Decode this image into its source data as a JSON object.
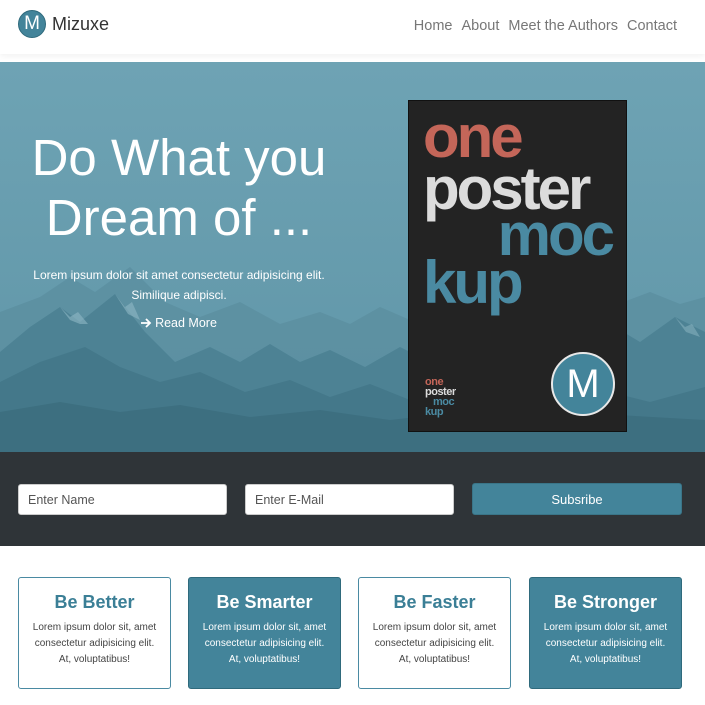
{
  "header": {
    "logo_letter": "M",
    "brand": "Mizuxe",
    "nav": [
      "Home",
      "About",
      "Meet the Authors",
      "Contact"
    ]
  },
  "hero": {
    "title_line1": "Do What you",
    "title_line2": "Dream of ...",
    "text_line1": "Lorem ipsum dolor sit amet consectetur adipisicing elit.",
    "text_line2": "Similique adipisci.",
    "read_more_label": "Read More",
    "read_more_icon": "arrow-right-icon"
  },
  "poster": {
    "line1": "one",
    "line2": "poster",
    "line3": "moc",
    "line4": "kup",
    "mini_line1": "one",
    "mini_line2": "poster",
    "mini_line3": "moc",
    "mini_line4": "kup",
    "logo_letter": "M"
  },
  "subscribe": {
    "name_placeholder": "Enter Name",
    "email_placeholder": "Enter E-Mail",
    "button_label": "Subsribe"
  },
  "features": [
    {
      "title": "Be Better",
      "text": "Lorem ipsum dolor sit, amet consectetur adipisicing elit. At, voluptatibus!",
      "style": "light"
    },
    {
      "title": "Be Smarter",
      "text": "Lorem ipsum dolor sit, amet consectetur adipisicing elit. At, voluptatibus!",
      "style": "dark"
    },
    {
      "title": "Be Faster",
      "text": "Lorem ipsum dolor sit, amet consectetur adipisicing elit. At, voluptatibus!",
      "style": "light"
    },
    {
      "title": "Be Stronger",
      "text": "Lorem ipsum dolor sit, amet consectetur adipisicing elit. At, voluptatibus!",
      "style": "dark"
    }
  ],
  "colors": {
    "primary": "#43849a",
    "hero_bg": "#6a9fb0",
    "dark_band": "#2f3438",
    "poster_red": "#c46659",
    "poster_white": "#dcdcdc",
    "poster_blue": "#4a8aa2"
  }
}
